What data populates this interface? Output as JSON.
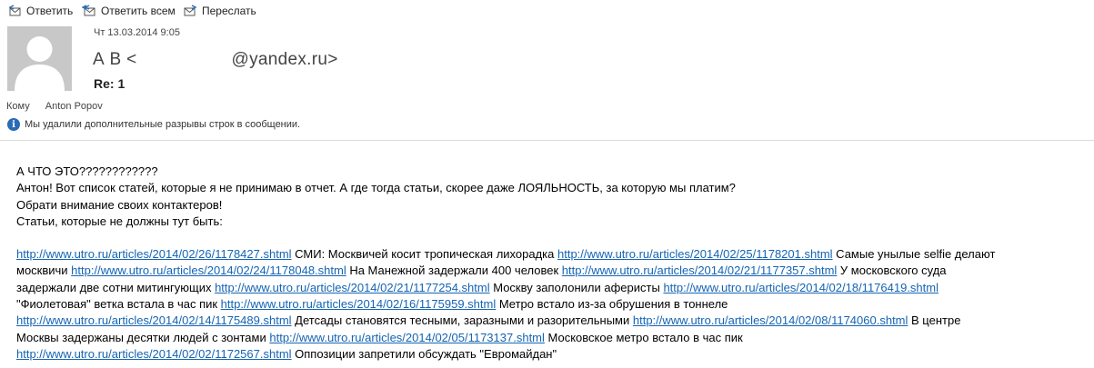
{
  "toolbar": {
    "reply": "Ответить",
    "reply_all": "Ответить всем",
    "forward": "Переслать"
  },
  "header": {
    "date": "Чт 13.03.2014 9:05",
    "sender_prefix": "А В <",
    "sender_suffix": "@yandex.ru>",
    "subject": "Re: 1",
    "to_label": "Кому",
    "to_name": "Anton Popov",
    "info_text": "Мы удалили дополнительные разрывы строк в сообщении."
  },
  "body": {
    "lines": [
      "А ЧТО ЭТО????????????",
      "Антон! Вот список статей, которые я не принимаю в отчет. А где тогда статьи, скорее даже ЛОЯЛЬНОСТЬ, за которую мы платим?",
      "Обрати внимание своих контактеров!",
      "Статьи, которые не должны тут быть:"
    ],
    "links_block": [
      [
        {
          "url": "http://www.utro.ru/articles/2014/02/26/1178427.shtml",
          "text": " СМИ: Москвичей косит тропическая лихорадка "
        },
        {
          "url": "http://www.utro.ru/articles/2014/02/25/1178201.shtml",
          "text": " Самые унылые selfie делают"
        }
      ],
      [
        {
          "url": "",
          "text": "москвичи "
        },
        {
          "url": "http://www.utro.ru/articles/2014/02/24/1178048.shtml",
          "text": " На Манежной задержали 400 человек "
        },
        {
          "url": "http://www.utro.ru/articles/2014/02/21/1177357.shtml",
          "text": " У московского суда"
        }
      ],
      [
        {
          "url": "",
          "text": "задержали две сотни митингующих "
        },
        {
          "url": "http://www.utro.ru/articles/2014/02/21/1177254.shtml",
          "text": " Москву заполонили аферисты "
        },
        {
          "url": "http://www.utro.ru/articles/2014/02/18/1176419.shtml",
          "text": ""
        }
      ],
      [
        {
          "url": "",
          "text": "\"Фиолетовая\" ветка встала в час пик "
        },
        {
          "url": "http://www.utro.ru/articles/2014/02/16/1175959.shtml",
          "text": " Метро встало из-за обрушения в тоннеле"
        }
      ],
      [
        {
          "url": "http://www.utro.ru/articles/2014/02/14/1175489.shtml",
          "text": " Детсады становятся тесными, заразными и разорительными "
        },
        {
          "url": "http://www.utro.ru/articles/2014/02/08/1174060.shtml",
          "text": " В центре"
        }
      ],
      [
        {
          "url": "",
          "text": "Москвы задержаны десятки людей с зонтами "
        },
        {
          "url": "http://www.utro.ru/articles/2014/02/05/1173137.shtml",
          "text": " Московское метро встало в час пик"
        }
      ],
      [
        {
          "url": "http://www.utro.ru/articles/2014/02/02/1172567.shtml",
          "text": " Оппозиции запретили обсуждать \"Евромайдан\""
        }
      ]
    ]
  },
  "colors": {
    "link": "#1464b4",
    "info_icon": "#2a6bb5",
    "avatar_bg": "#c8c8c8"
  }
}
